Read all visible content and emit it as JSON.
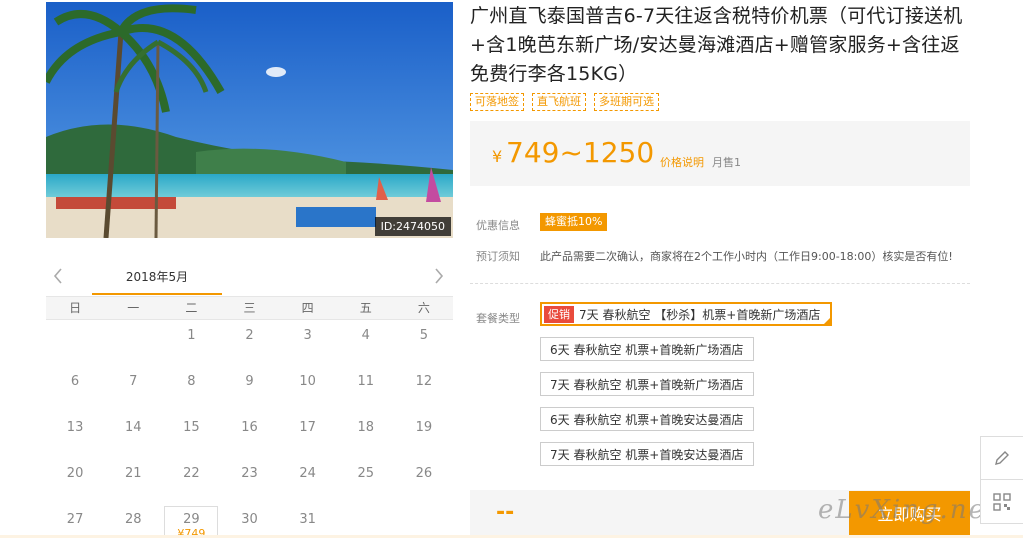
{
  "product": {
    "image_id": "ID:2474050",
    "title": "广州直飞泰国普吉6-7天往返含税特价机票（可代订接送机+含1晚芭东新广场/安达曼海滩酒店+赠管家服务+含往返免费行李各15KG）",
    "tags": [
      "可落地签",
      "直飞航班",
      "多班期可选"
    ]
  },
  "price": {
    "currency": "¥",
    "range": "749~1250",
    "note_link": "价格说明",
    "sold": "月售1"
  },
  "info": {
    "discount_label": "优惠信息",
    "discount_badge": "蜂蜜抵10%",
    "notice_label": "预订须知",
    "notice_text": "此产品需要二次确认，商家将在2个工作小时内（工作日9:00-18:00）核实是否有位!"
  },
  "packages": {
    "label": "套餐类型",
    "items": [
      {
        "badge": "促销",
        "text": "7天 春秋航空 【秒杀】机票+首晚新广场酒店",
        "selected": true
      },
      {
        "badge": "",
        "text": "6天 春秋航空 机票+首晚新广场酒店",
        "selected": false
      },
      {
        "badge": "",
        "text": "7天 春秋航空 机票+首晚新广场酒店",
        "selected": false
      },
      {
        "badge": "",
        "text": "6天 春秋航空 机票+首晚安达曼酒店",
        "selected": false
      },
      {
        "badge": "",
        "text": "7天 春秋航空 机票+首晚安达曼酒店",
        "selected": false
      }
    ]
  },
  "calendar": {
    "month": "2018年5月",
    "weekdays": [
      "日",
      "一",
      "二",
      "三",
      "四",
      "五",
      "六"
    ],
    "days": [
      "",
      "",
      "1",
      "2",
      "3",
      "4",
      "5",
      "6",
      "7",
      "8",
      "9",
      "10",
      "11",
      "12",
      "13",
      "14",
      "15",
      "16",
      "17",
      "18",
      "19",
      "20",
      "21",
      "22",
      "23",
      "24",
      "25",
      "26",
      "27",
      "28",
      "29",
      "30",
      "31",
      "",
      ""
    ],
    "price_day": "29",
    "price_label": "¥749"
  },
  "total": "--",
  "buy_label": "立即购买",
  "watermark": "eLvXing.net",
  "colors": {
    "accent": "#f39800",
    "promo_red": "#e94b3c",
    "panel_bg": "#f5f5f5"
  },
  "icons": {
    "prev": "chevron-left-icon",
    "next": "chevron-right-icon",
    "edit": "pencil-icon",
    "qr": "qr-code-icon"
  }
}
